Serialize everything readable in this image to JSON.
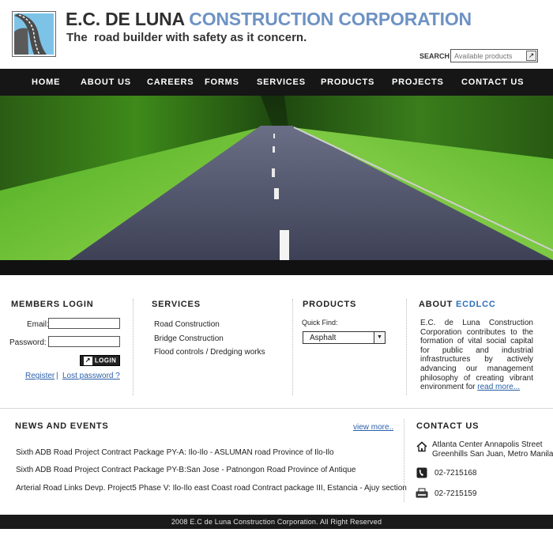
{
  "brand": {
    "name_part1": "E.C. DE LUNA",
    "name_part2": "CONSTRUCTION CORPORATION",
    "tagline": "The  road builder with safety as it concern.",
    "logo_icon": "road-logo-icon"
  },
  "search": {
    "label": "SEARCH",
    "placeholder": "Available products",
    "go_icon": "arrow-up-right-icon"
  },
  "nav": {
    "items": [
      "HOME",
      "ABOUT US",
      "CAREERS",
      "FORMS",
      "SERVICES",
      "PRODUCTS",
      "PROJECTS",
      "CONTACT US"
    ]
  },
  "members": {
    "title": "MEMBERS LOGIN",
    "email_label": "Email:",
    "password_label": "Password:",
    "login_button": "LOGIN",
    "register_link": "Register",
    "separator": "|",
    "lost_password_link": "Lost password ?"
  },
  "services": {
    "title": "SERVICES",
    "items": [
      "Road Construction",
      "Bridge Construction",
      "Flood controls / Dredging works"
    ]
  },
  "products": {
    "title": "PRODUCTS",
    "quick_find_label": "Quick Find:",
    "selected": "Asphalt"
  },
  "about": {
    "title_prefix": "ABOUT ",
    "title_highlight": "ECDLCC",
    "text": "E.C. de Luna Construction Corporation contributes to the formation of vital social capital for public and industrial infrastructures by actively advancing our management philosophy of creating vibrant environment for ",
    "read_more": "read more..."
  },
  "news": {
    "title": "NEWS AND EVENTS",
    "view_more": "view more..",
    "items": [
      "Sixth ADB Road Project Contract Package PY-A: Ilo-Ilo - ASLUMAN road Province of Ilo-Ilo",
      "Sixth ADB Road Project Contract Package PY-B:San Jose - Patnongon Road Province of Antique",
      "Arterial Road Links Devp. Project5 Phase V: Ilo-Ilo east Coast road Contract package III, Estancia - Ajuy section"
    ]
  },
  "contact": {
    "title": "CONTACT US",
    "address_line1": "Atlanta Center Annapolis Street",
    "address_line2": "Greenhills San Juan, Metro Manila",
    "phone": "02-7215168",
    "fax": "02-7215159"
  },
  "footer": {
    "text": "2008 E.C de Luna Construction Corporation. All Right Reserved"
  },
  "colors": {
    "nav_background": "#161616",
    "brand_accent": "#6e93c4",
    "link": "#2a5fa8",
    "about_highlight": "#2d6fb8"
  }
}
